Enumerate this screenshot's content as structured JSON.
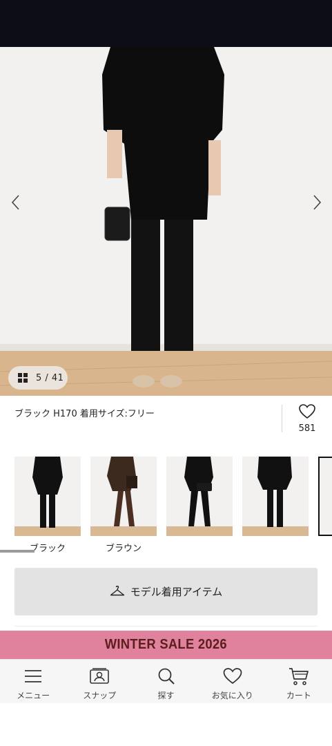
{
  "gallery": {
    "counter_text": "5 / 41",
    "caption": "ブラック H170 着用サイズ:フリー"
  },
  "favorite": {
    "count": "581"
  },
  "colors": [
    {
      "label": "ブラック",
      "pants_color": "#111111",
      "top_color": "#111111"
    },
    {
      "label": "ブラウン",
      "pants_color": "#4a2f22",
      "top_color": "#3d2a1f"
    },
    {
      "label": "",
      "pants_color": "#111111",
      "top_color": "#111111"
    },
    {
      "label": "",
      "pants_color": "#111111",
      "top_color": "#111111"
    },
    {
      "label": "",
      "pants_color": "#111111",
      "top_color": "#111111"
    }
  ],
  "model_button": {
    "label": "モデル着用アイテム"
  },
  "banner": {
    "text": "WINTER SALE 2026",
    "bg": "#e0829e",
    "fg": "#5b1e1c"
  },
  "bottom_nav": [
    {
      "label": "メニュー",
      "icon": "menu-icon"
    },
    {
      "label": "スナップ",
      "icon": "snap-icon"
    },
    {
      "label": "探す",
      "icon": "search-icon"
    },
    {
      "label": "お気に入り",
      "icon": "heart-icon"
    },
    {
      "label": "カート",
      "icon": "cart-icon"
    }
  ]
}
